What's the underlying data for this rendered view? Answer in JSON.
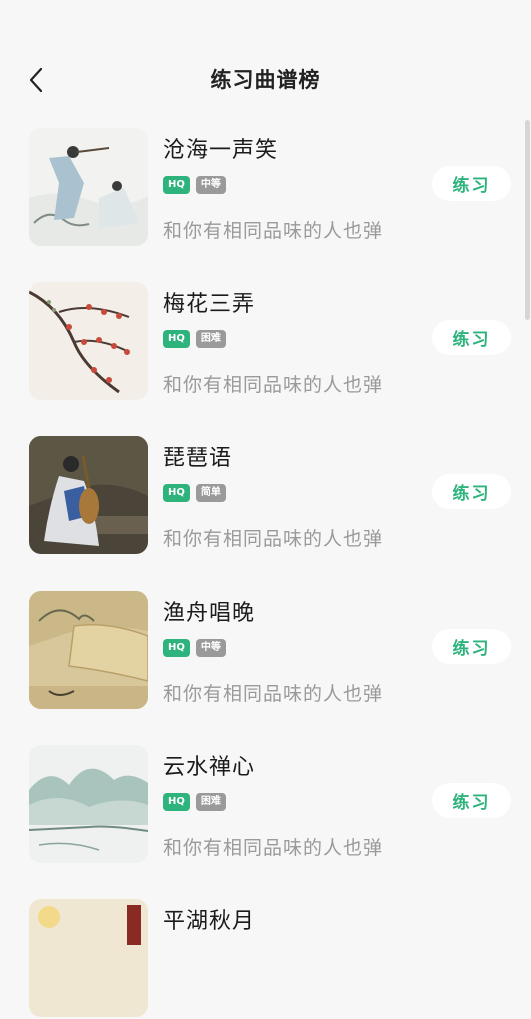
{
  "header": {
    "title": "练习曲谱榜"
  },
  "items": [
    {
      "title": "沧海一声笑",
      "hq": "HQ",
      "level": "中等",
      "subtitle": "和你有相同品味的人也弹",
      "button": "练习",
      "thumb": "scholars-flute-icon"
    },
    {
      "title": "梅花三弄",
      "hq": "HQ",
      "level": "困难",
      "subtitle": "和你有相同品味的人也弹",
      "button": "练习",
      "thumb": "plum-blossom-icon"
    },
    {
      "title": "琵琶语",
      "hq": "HQ",
      "level": "简单",
      "subtitle": "和你有相同品味的人也弹",
      "button": "练习",
      "thumb": "pipa-player-icon"
    },
    {
      "title": "渔舟唱晚",
      "hq": "HQ",
      "level": "中等",
      "subtitle": "和你有相同品味的人也弹",
      "button": "练习",
      "thumb": "fishing-boat-icon"
    },
    {
      "title": "云水禅心",
      "hq": "HQ",
      "level": "困难",
      "subtitle": "和你有相同品味的人也弹",
      "button": "练习",
      "thumb": "mountain-lake-icon"
    },
    {
      "title": "平湖秋月",
      "hq": "",
      "level": "",
      "subtitle": "",
      "button": "",
      "thumb": "autumn-moon-icon"
    }
  ]
}
